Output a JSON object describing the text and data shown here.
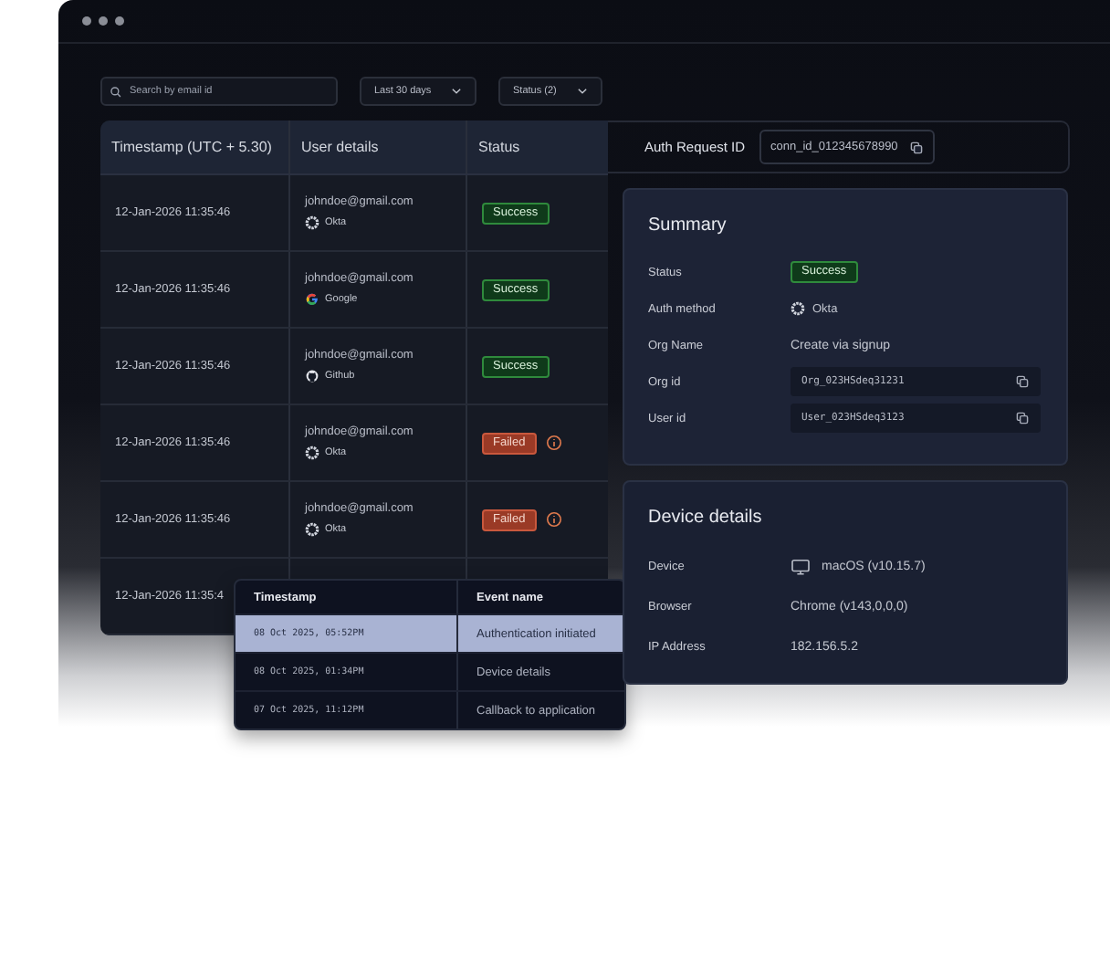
{
  "filters": {
    "search": {
      "placeholder": "Search by email id"
    },
    "dropdowns": [
      "Last 30 days",
      "Status (2)"
    ]
  },
  "table": {
    "columns": [
      "Timestamp (UTC + 5.30)",
      "User details",
      "Status"
    ],
    "rows": [
      {
        "timestamp": "12-Jan-2026 11:35:46",
        "email": "johndoe@gmail.com",
        "provider": {
          "kind": "okta",
          "name": "Okta"
        },
        "status": {
          "kind": "success",
          "label": "Success"
        }
      },
      {
        "timestamp": "12-Jan-2026 11:35:46",
        "email": "johndoe@gmail.com",
        "provider": {
          "kind": "google",
          "name": "Google"
        },
        "status": {
          "kind": "success",
          "label": "Success"
        }
      },
      {
        "timestamp": "12-Jan-2026 11:35:46",
        "email": "johndoe@gmail.com",
        "provider": {
          "kind": "github",
          "name": "Github"
        },
        "status": {
          "kind": "success",
          "label": "Success"
        }
      },
      {
        "timestamp": "12-Jan-2026 11:35:46",
        "email": "johndoe@gmail.com",
        "provider": {
          "kind": "okta",
          "name": "Okta"
        },
        "status": {
          "kind": "failed",
          "label": "Failed"
        }
      },
      {
        "timestamp": "12-Jan-2026 11:35:46",
        "email": "johndoe@gmail.com",
        "provider": {
          "kind": "okta",
          "name": "Okta"
        },
        "status": {
          "kind": "failed",
          "label": "Failed"
        }
      },
      {
        "timestamp": "12-Jan-2026 11:35:4"
      }
    ]
  },
  "auth_request": {
    "label": "Auth Request ID",
    "value": "conn_id_012345678990"
  },
  "summary": {
    "title": "Summary",
    "fields": [
      {
        "label": "Status",
        "kind": "badge",
        "value": "Success"
      },
      {
        "label": "Auth method",
        "kind": "okta",
        "value": "Okta"
      },
      {
        "label": "Org Name",
        "kind": "text",
        "value": "Create via signup"
      },
      {
        "label": "Org id",
        "kind": "code",
        "value": "Org_023HSdeq31231"
      },
      {
        "label": "User id",
        "kind": "code",
        "value": "User_023HSdeq3123"
      }
    ]
  },
  "device": {
    "title": "Device details",
    "fields": [
      {
        "label": "Device",
        "kind": "monitor",
        "value": "macOS (v10.15.7)"
      },
      {
        "label": "Browser",
        "kind": "text",
        "value": "Chrome (v143,0,0,0)"
      },
      {
        "label": "IP Address",
        "kind": "text",
        "value": "182.156.5.2"
      }
    ]
  },
  "events": {
    "columns": [
      "Timestamp",
      "Event name"
    ],
    "rows": [
      {
        "timestamp": "08 Oct 2025, 05:52PM",
        "name": "Authentication initiated",
        "selected": true
      },
      {
        "timestamp": "08 Oct 2025, 01:34PM",
        "name": "Device details",
        "selected": false
      },
      {
        "timestamp": "07 Oct 2025, 11:12PM",
        "name": "Callback to application",
        "selected": false
      }
    ]
  }
}
